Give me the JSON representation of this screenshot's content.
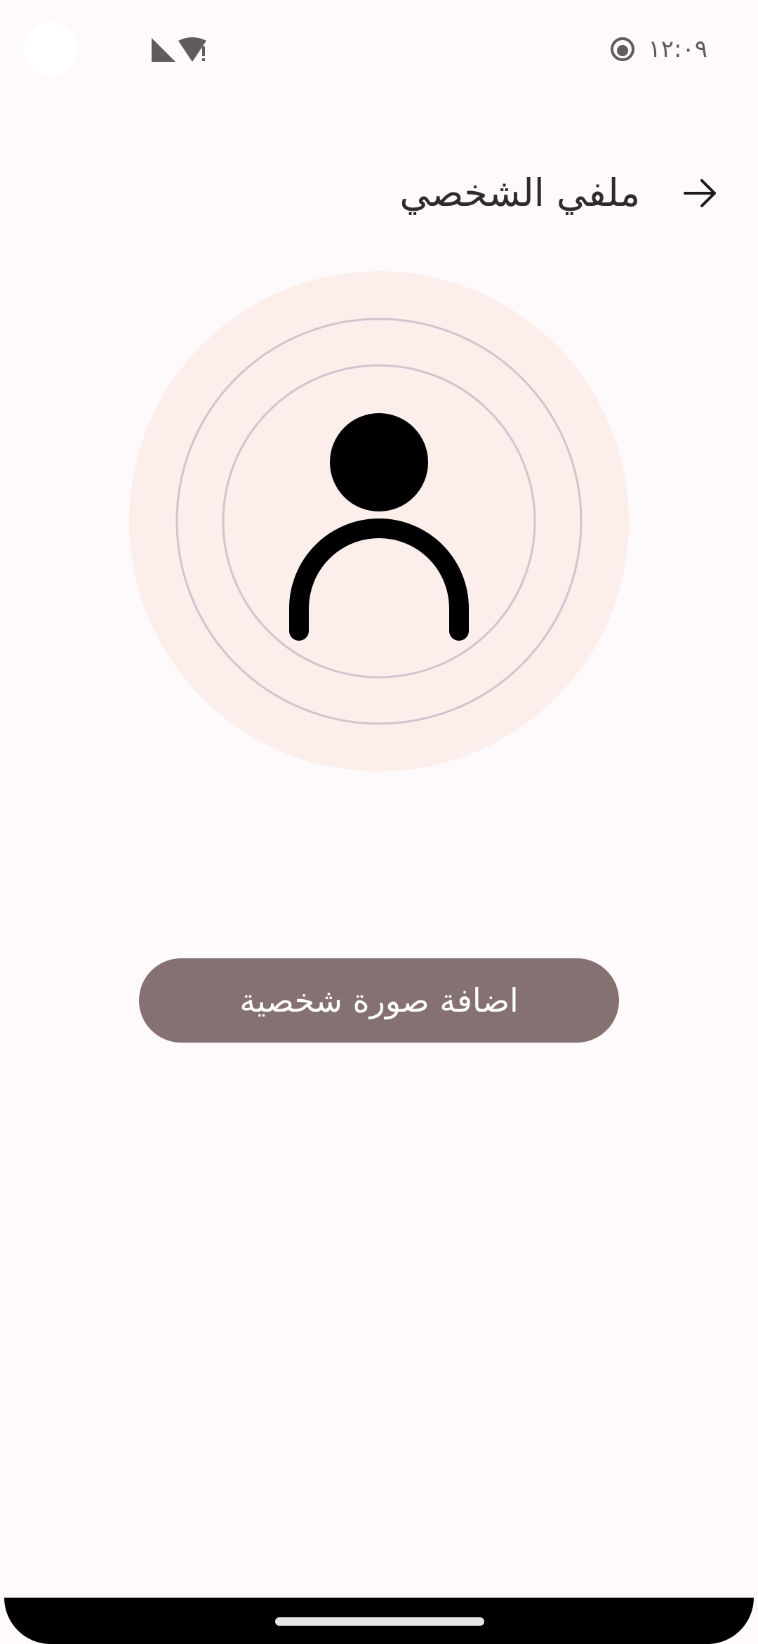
{
  "status_bar": {
    "time": "١٢:٠٩",
    "icons": [
      "signal-icon",
      "wifi-alert-icon",
      "face-status-icon"
    ]
  },
  "header": {
    "title": "ملفي الشخصي",
    "back_icon": "arrow-right-icon"
  },
  "avatar": {
    "icon": "person-placeholder-icon"
  },
  "actions": {
    "add_photo_label": "اضافة صورة شخصية"
  },
  "colors": {
    "background": "#fefafb",
    "avatar_outer": "#fbeeeb",
    "ring": "#cfc5cd",
    "button": "#867172",
    "button_text": "#ffffff"
  }
}
